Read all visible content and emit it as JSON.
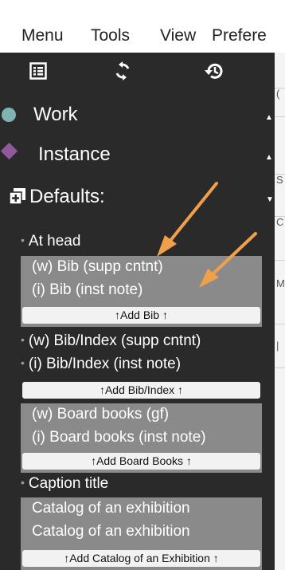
{
  "menubar": {
    "items": [
      "Menu",
      "Tools",
      "View",
      "Prefere"
    ]
  },
  "toolbar": {
    "icons": [
      "list-icon",
      "sync-icon",
      "history-icon"
    ]
  },
  "sections": {
    "work": {
      "label": "Work",
      "color": "#7fb3b3"
    },
    "instance": {
      "label": "Instance",
      "color": "#8f5a9a"
    },
    "defaults": {
      "label": "Defaults:"
    }
  },
  "defaults_list": {
    "at_head": "At head",
    "bib_group": {
      "rows": [
        "(w) Bib (supp cntnt)",
        "(i) Bib (inst note)"
      ],
      "add_label": "↑Add Bib ↑"
    },
    "bib_index_work": "(w) Bib/Index (supp cntnt)",
    "bib_index_inst": "(i) Bib/Index (inst note)",
    "bib_index_add": "↑Add Bib/Index ↑",
    "board_books_group": {
      "rows": [
        "(w) Board books (gf)",
        "(i) Board books (inst note)"
      ],
      "add_label": "↑Add Board Books ↑"
    },
    "caption_title": "Caption title",
    "catalog_group": {
      "rows": [
        "Catalog of an exhibition",
        "Catalog of an exhibition"
      ],
      "add_label": "↑Add Catalog of an Exhibition ↑"
    }
  },
  "annotation_color": "#f0a04b",
  "right_strip_chars": [
    "(",
    "S",
    "C",
    "M",
    "|"
  ]
}
